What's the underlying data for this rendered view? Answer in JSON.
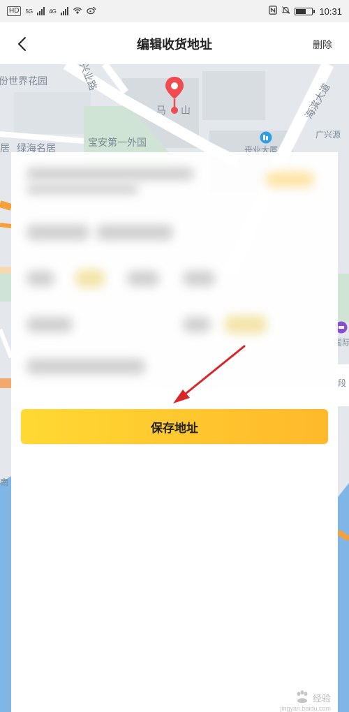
{
  "status_bar": {
    "network_badge": "HD",
    "net_1": "5G",
    "net_2": "4G",
    "time": "10:31",
    "battery_level": 0.62
  },
  "nav": {
    "back_icon": "chevron-left-icon",
    "title": "编辑收货地址",
    "action_label": "删除"
  },
  "map": {
    "labels": [
      "份世界花园",
      "兴业路",
      "马",
      "山",
      "海滨大道",
      "广兴源",
      "居",
      "绿海名居",
      "宝安第一外国",
      "丧业大厦",
      "国际",
      "段",
      "南"
    ]
  },
  "actions": {
    "save_label": "保存地址"
  },
  "colors": {
    "accent_start": "#ffd933",
    "accent_end": "#ffb92b",
    "pin": "#f24b4f",
    "annotation_arrow": "#d9262b"
  },
  "watermark": {
    "text": "经验",
    "subtext": "jingyan.baidu.com"
  }
}
